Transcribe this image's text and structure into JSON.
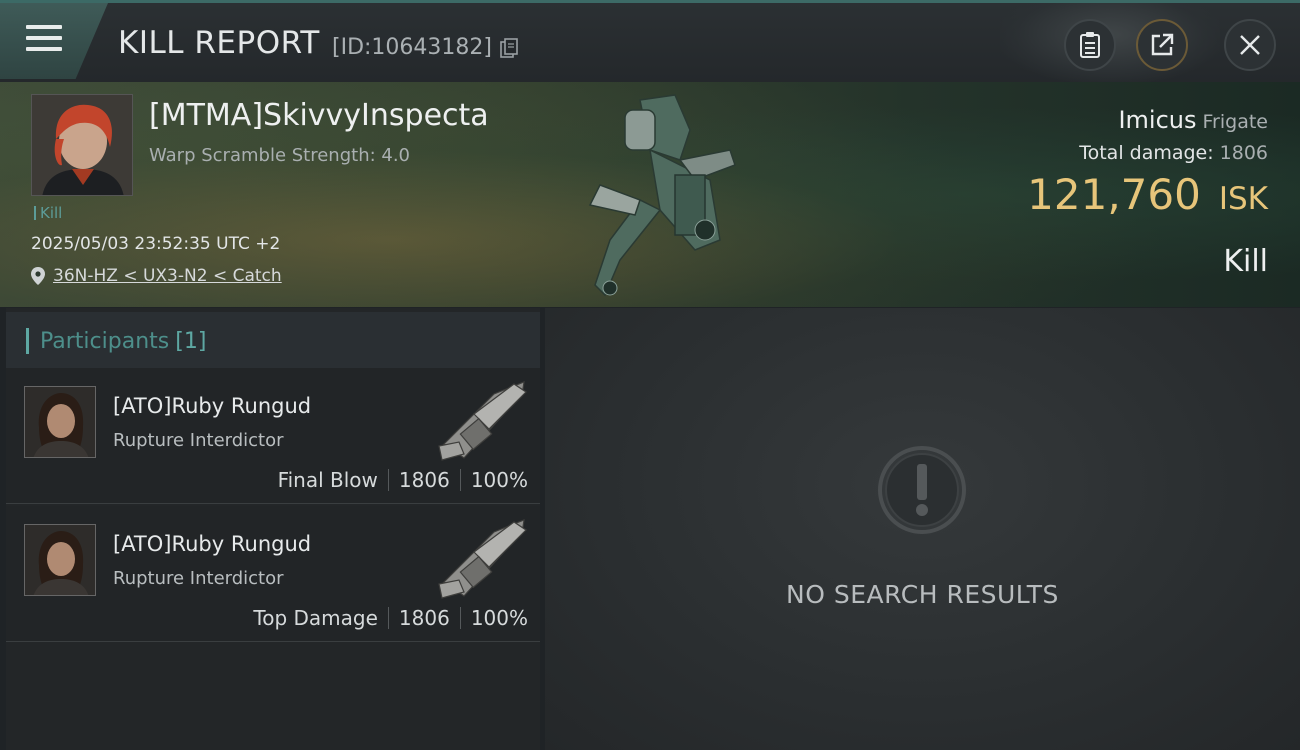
{
  "header": {
    "title": "KILL REPORT",
    "report_id": "[ID:10643182]",
    "icons": [
      "menu-icon",
      "copy-icon",
      "clipboard-icon",
      "share-icon",
      "close-icon"
    ]
  },
  "victim": {
    "name": "[MTMA]SkivvyInspecta",
    "warp_scramble": "Warp Scramble Strength: 4.0",
    "tag": "Kill",
    "datetime": "2025/05/03 23:52:35 UTC +2",
    "location": "36N-HZ < UX3-N2 < Catch",
    "ship_name": "Imicus",
    "ship_class": "Frigate",
    "total_damage_label": "Total damage:",
    "total_damage": "1806",
    "isk_value": "121,760",
    "isk_currency": "ISK",
    "kill_type": "Kill"
  },
  "participants": {
    "label": "Participants",
    "count": "[1]",
    "rows": [
      {
        "name": "[ATO]Ruby Rungud",
        "ship": "Rupture Interdictor",
        "role": "Final Blow",
        "damage": "1806",
        "percent": "100%"
      },
      {
        "name": "[ATO]Ruby Rungud",
        "ship": "Rupture Interdictor",
        "role": "Top Damage",
        "damage": "1806",
        "percent": "100%"
      }
    ]
  },
  "results": {
    "empty_text": "NO SEARCH RESULTS"
  },
  "colors": {
    "accent_teal": "#5ea8a3",
    "isk_gold": "#e7c57a"
  }
}
